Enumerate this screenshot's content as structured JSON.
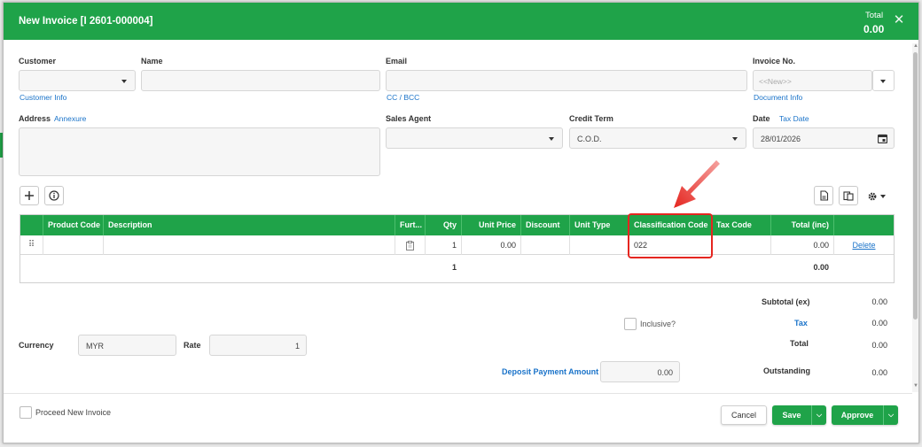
{
  "header": {
    "title": "New Invoice [I 2601-000004]",
    "total_label": "Total",
    "total_value": "0.00"
  },
  "form": {
    "customer_label": "Customer",
    "customer_info_link": "Customer Info",
    "name_label": "Name",
    "email_label": "Email",
    "cc_bcc_link": "CC / BCC",
    "invoice_no_label": "Invoice No.",
    "invoice_no_placeholder": "<<New>>",
    "document_info_link": "Document Info",
    "address_label": "Address",
    "annexure_link": "Annexure",
    "sales_agent_label": "Sales Agent",
    "credit_term_label": "Credit Term",
    "credit_term_value": "C.O.D.",
    "date_label": "Date",
    "tax_date_link": "Tax Date",
    "date_value": "28/01/2026"
  },
  "grid": {
    "columns": [
      "Product Code",
      "Description",
      "Furt...",
      "Qty",
      "Unit Price",
      "Discount",
      "Unit Type",
      "Classification Code",
      "Tax Code",
      "Total (inc)"
    ],
    "row": {
      "qty": "1",
      "unit_price": "0.00",
      "classification_code": "022",
      "total": "0.00",
      "delete_label": "Delete"
    },
    "summary": {
      "qty_total": "1",
      "total": "0.00"
    }
  },
  "totals": {
    "subtotal_label": "Subtotal (ex)",
    "subtotal_value": "0.00",
    "inclusive_label": "Inclusive?",
    "tax_label": "Tax",
    "tax_value": "0.00",
    "total_label": "Total",
    "total_value": "0.00",
    "outstanding_label": "Outstanding",
    "outstanding_value": "0.00",
    "deposit_label": "Deposit Payment Amount",
    "deposit_value": "0.00"
  },
  "currency": {
    "currency_label": "Currency",
    "currency_value": "MYR",
    "rate_label": "Rate",
    "rate_value": "1"
  },
  "footer": {
    "proceed_label": "Proceed New Invoice",
    "cancel_label": "Cancel",
    "save_label": "Save",
    "approve_label": "Approve"
  },
  "colors": {
    "brand_green": "#1fa349",
    "highlight_red": "#e52620",
    "link_blue": "#1a73c9"
  }
}
